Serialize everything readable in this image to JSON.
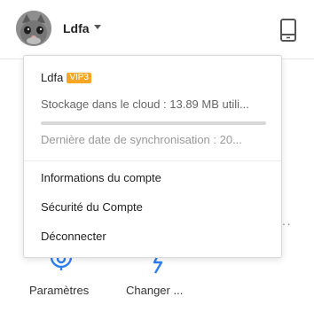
{
  "header": {
    "username": "Ldfa",
    "avatar_icon": "cat-avatar-icon",
    "device_icon": "phone-device-icon"
  },
  "dropdown": {
    "user_name": "Ldfa",
    "vip_badge": "VIP3",
    "vip_color": "#f6a623",
    "storage_text": "Stockage dans le cloud : 13.89 MB utili...",
    "storage_used_fraction": 0.0,
    "progress_color": "#3c8cf0",
    "sync_text": "Dernière date de synchronisation : 20...",
    "menu": [
      {
        "label": "Informations du compte"
      },
      {
        "label": "Sécurité du Compte"
      },
      {
        "label": "Déconnecter"
      }
    ]
  },
  "background": {
    "tools": [
      {
        "label": "Paramètres",
        "icon": "gear-icon"
      },
      {
        "label": "Changer ...",
        "icon": "lightning-icon"
      }
    ],
    "accent_color": "#2f7ff0"
  }
}
